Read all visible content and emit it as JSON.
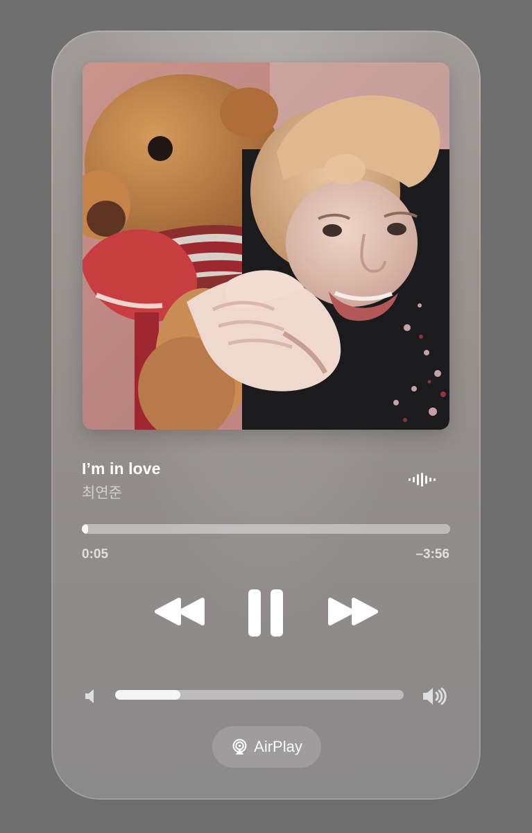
{
  "track": {
    "title": "I’m in love",
    "artist": "최연준"
  },
  "progress": {
    "elapsed": "0:05",
    "remaining": "–3:56",
    "fraction": 0.017
  },
  "volume": {
    "fraction": 0.225
  },
  "airplay": {
    "label": "AirPlay"
  },
  "icons": {
    "waveform": "waveform-icon",
    "rewind": "rewind-icon",
    "pause": "pause-icon",
    "forward": "fast-forward-icon",
    "volume_low": "speaker-low-icon",
    "volume_high": "speaker-high-icon",
    "airplay": "airplay-icon"
  },
  "colors": {
    "background": "#6f6f6f",
    "card": "#958f8c",
    "foreground": "#ffffff",
    "muted_text": "#d7d4d3",
    "track": "#d0cdcb"
  }
}
